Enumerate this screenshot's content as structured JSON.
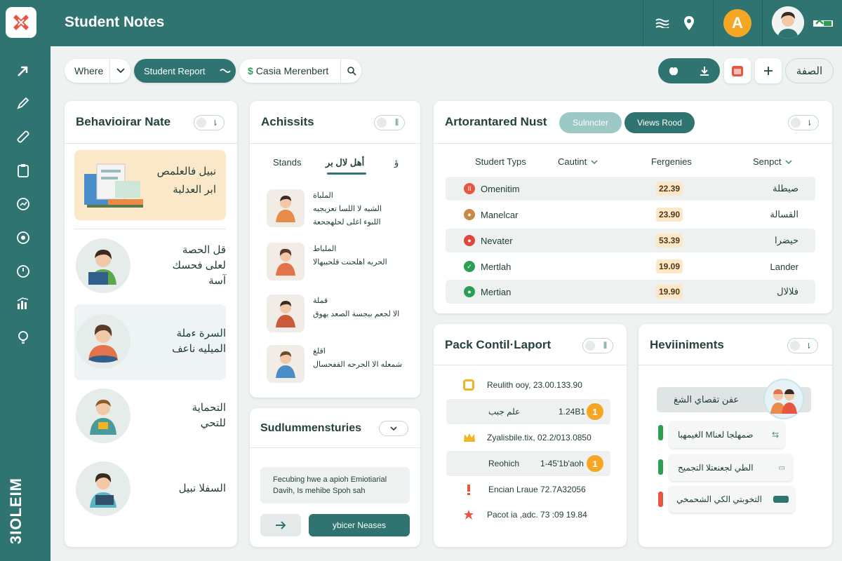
{
  "app": {
    "title": "Student Notes",
    "brand": "3IOLEIM",
    "avatar_initial": "A"
  },
  "filters": {
    "where": "Where",
    "report": "Student Report",
    "student": "Casia Merenbert",
    "lang": "الصفة"
  },
  "behavioral": {
    "title": "Behavioirar Nate",
    "toggle": "⇂",
    "items": [
      {
        "lines": [
          "نبيل فالعلمص",
          "ابر العدلبة"
        ]
      },
      {
        "lines": [
          "قل الحصة",
          "لعلى فحسك",
          "آسة"
        ]
      },
      {
        "lines": [
          "السرة ءملة",
          "الميليه ناعف"
        ]
      },
      {
        "lines": [
          "التحماية",
          "للتحي"
        ]
      },
      {
        "lines": [
          "السفلا نبيل"
        ]
      }
    ]
  },
  "achievements": {
    "title": "Achissits",
    "toggle": "⫼",
    "tabs": [
      "Stands",
      "أهل لال بر",
      "ؤ"
    ],
    "items": [
      {
        "lines": [
          "الملباة",
          "الشيه لا اللسا تعزيجيه",
          "اللبوء اغلى لحلهجحعة"
        ]
      },
      {
        "lines": [
          "الملباط",
          "الحربه اهلحنت قلحيبهالا"
        ]
      },
      {
        "lines": [
          "قملة",
          "الا لجعم بيجسة الصعد يهوق"
        ]
      },
      {
        "lines": [
          "اقلغ",
          "شمعله الا الجرحه القفحسال"
        ]
      }
    ]
  },
  "summaries": {
    "title": "Sudlummensturies",
    "text": "Fecubing hwe a apioh Emiotiarial Davih, Is mehibe Spoh sah",
    "action": "ybicer Neases"
  },
  "attendance": {
    "title": "Artorantared Nust",
    "btn1": "Sulnncter",
    "btn2": "Views Rood",
    "columns": [
      "Studert Typs",
      "Cautint",
      "Fergenies",
      "Senpct"
    ],
    "rows": [
      {
        "name": "Omenitim",
        "value": "22.39",
        "note": "صيطلة",
        "color": "#e8563f",
        "glyph": "II"
      },
      {
        "name": "Manelcar",
        "value": "23.90",
        "note": "القسالة",
        "color": "#c9884a",
        "glyph": "●"
      },
      {
        "name": "Nevater",
        "value": "53.39",
        "note": "حيضرا",
        "color": "#e0483a",
        "glyph": "●"
      },
      {
        "name": "Mertlah",
        "value": "19.09",
        "note": "Lander",
        "color": "#2e9e55",
        "glyph": "✓"
      },
      {
        "name": "Mertian",
        "value": "19.90",
        "note": "فلالال",
        "color": "#2e9e55",
        "glyph": "●"
      }
    ]
  },
  "pack": {
    "title": "Pack Contil·Laport",
    "rows": [
      {
        "text": "Reulith ooy, 23.00.133.90",
        "icon_color": "#f0b429",
        "badge": ""
      },
      {
        "text": "علم جبب",
        "value": "1.24B1",
        "badge": "1"
      },
      {
        "text": "Zyalisbile.tix, 02.2/013.0850",
        "icon_color": "#f0b429",
        "badge": ""
      },
      {
        "text": "Reohich",
        "value": "1-45'1b'aoh",
        "badge": "1"
      },
      {
        "text": "Encian Lraue 72.7A32056",
        "icon_color": "#e8563f",
        "badge": ""
      },
      {
        "text": "Pacot ia ,adc. 73 :09 19.84",
        "icon_color": "#e8563f",
        "badge": ""
      }
    ]
  },
  "heviniments": {
    "title": "Heviiniments",
    "header": "عفن تقصاي الشغ",
    "items": [
      {
        "text": "الغيمهبا Mصمهلجا لعنا",
        "flag": "#2e9e55",
        "mark": "⇆"
      },
      {
        "text": "الطي لجعنعتلا التجميح",
        "flag": "#2e9e55",
        "mark": "▭"
      },
      {
        "text": "التخوبتي الكي الشحمخي",
        "flag": "#e8563f",
        "mark": ""
      }
    ]
  }
}
